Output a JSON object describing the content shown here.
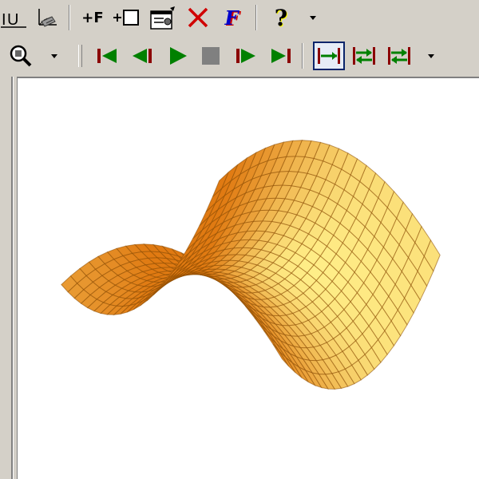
{
  "toolbar": {
    "row1": [
      {
        "name": "axis-labels-button",
        "icon": "xyz-axis-icon"
      },
      {
        "name": "grid-3d-button",
        "icon": "grid-3d-icon"
      },
      {
        "name": "add-function-button",
        "icon": "add-function-icon",
        "label": "+F"
      },
      {
        "name": "add-object-button",
        "icon": "add-box-icon",
        "label": "+"
      },
      {
        "name": "properties-button",
        "icon": "properties-icon"
      },
      {
        "name": "delete-button",
        "icon": "delete-x-icon"
      },
      {
        "name": "function-button",
        "icon": "function-f-icon",
        "label": "F"
      },
      {
        "name": "help-button",
        "icon": "help-icon",
        "label": "?"
      },
      {
        "name": "toolbar-options-button",
        "icon": "chevron-down-icon"
      }
    ],
    "row2": [
      {
        "name": "zoom-button",
        "icon": "zoom-icon"
      },
      {
        "name": "zoom-options-button",
        "icon": "chevron-down-icon"
      },
      {
        "name": "first-frame-button",
        "icon": "first-frame-icon"
      },
      {
        "name": "step-back-button",
        "icon": "step-back-icon"
      },
      {
        "name": "play-button",
        "icon": "play-icon"
      },
      {
        "name": "stop-button",
        "icon": "stop-icon"
      },
      {
        "name": "step-forward-button",
        "icon": "step-forward-icon"
      },
      {
        "name": "last-frame-button",
        "icon": "last-frame-icon"
      },
      {
        "name": "single-cycle-button",
        "icon": "single-cycle-icon",
        "pressed": true
      },
      {
        "name": "continuous-button",
        "icon": "continuous-icon"
      },
      {
        "name": "oscillate-button",
        "icon": "oscillate-icon"
      },
      {
        "name": "animation-options-button",
        "icon": "chevron-down-icon"
      }
    ]
  },
  "colors": {
    "toolbar_bg": "#d4d0c8",
    "red": "#cc0000",
    "blue": "#0000cc",
    "dark_red": "#8b0000",
    "green": "#008000",
    "gray": "#808080",
    "surface_light": "#ffee88",
    "surface_dark": "#e07a12",
    "surface_edge": "#8a4a00"
  },
  "plot": {
    "type": "3d-surface",
    "shape": "saddle (hyperbolic paraboloid)",
    "grid_lines": true
  }
}
